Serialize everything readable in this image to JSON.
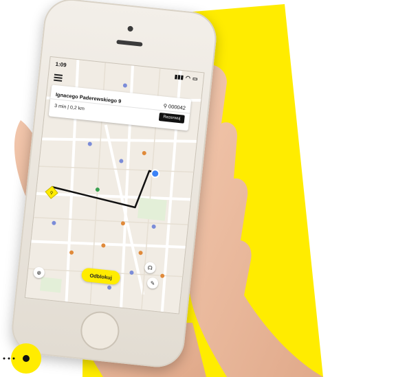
{
  "status_bar": {
    "time": "1:09"
  },
  "station_card": {
    "address": "Ignacego Paderewskiego 9",
    "bike_id": "000042",
    "eta": "3 min  |  0,2 km",
    "reserve_label": "Rezerwuj"
  },
  "unlock_label": "Odblokuj",
  "icons": {
    "menu": "hamburger-menu-icon",
    "bike": "bicycle-icon",
    "locate": "crosshair-icon",
    "support": "headset-icon",
    "service": "wrench-icon",
    "station": "bike-station-marker-icon",
    "user": "user-location-icon"
  },
  "colors": {
    "brand_yellow": "#ffec00",
    "route": "#111111",
    "user_dot": "#3b82f6"
  }
}
